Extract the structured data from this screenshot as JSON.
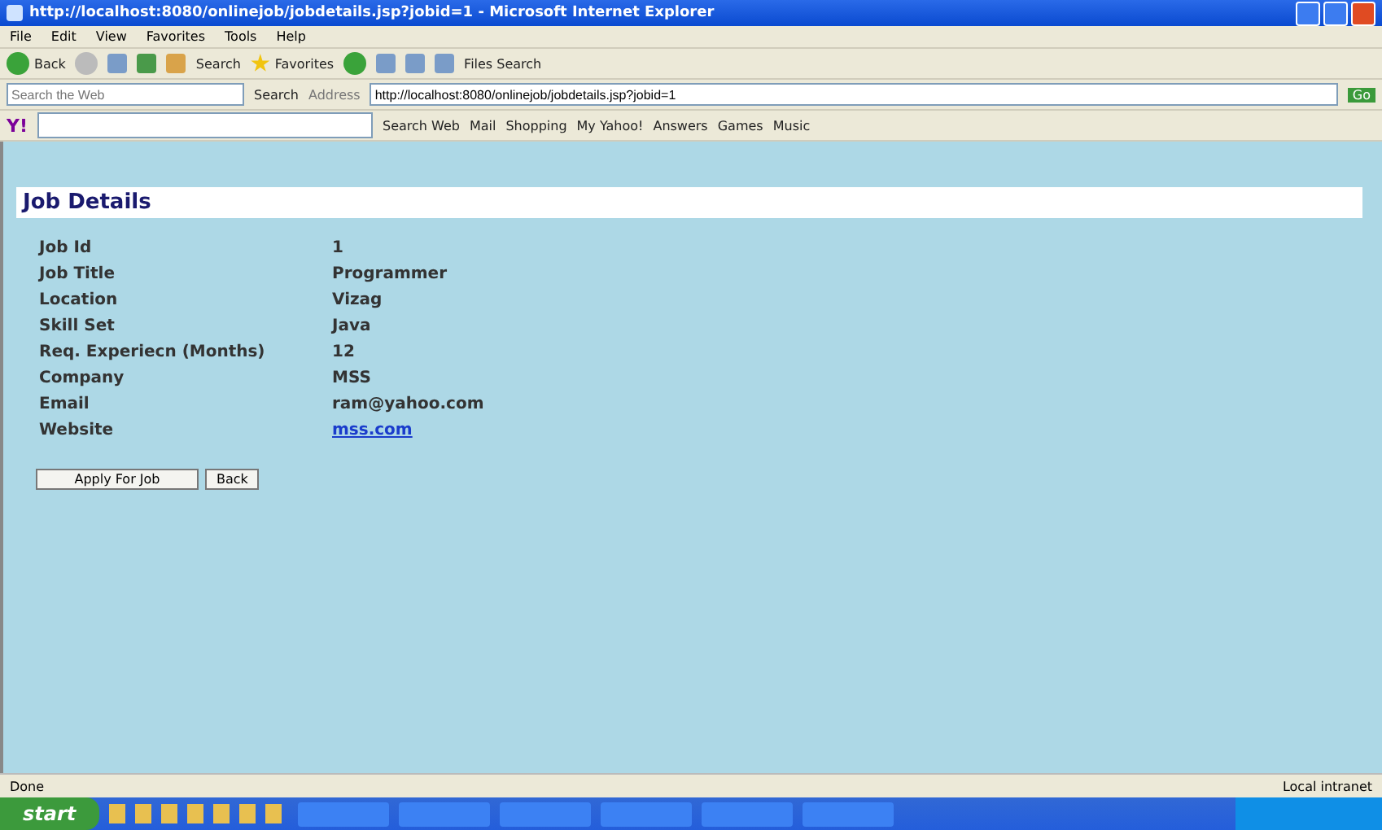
{
  "window": {
    "title": "http://localhost:8080/onlinejob/jobdetails.jsp?jobid=1 - Microsoft Internet Explorer"
  },
  "menu": [
    "File",
    "Edit",
    "View",
    "Favorites",
    "Tools",
    "Help"
  ],
  "toolbar": {
    "back": "Back",
    "search": "Search",
    "favorites": "Favorites",
    "files_search": "Files Search"
  },
  "address_bar": {
    "search_placeholder": "Search the Web",
    "search_button": "Search",
    "address_label": "Address",
    "url": "http://localhost:8080/onlinejob/jobdetails.jsp?jobid=1",
    "go": "Go"
  },
  "yahoo_bar": {
    "logo": "Y!",
    "items": [
      "Search Web",
      "Mail",
      "Shopping",
      "My Yahoo!",
      "Answers",
      "Games",
      "Music"
    ]
  },
  "page": {
    "heading": "Job Details",
    "fields": [
      {
        "label": "Job Id",
        "value": "1",
        "kind": "text"
      },
      {
        "label": "Job Title",
        "value": "Programmer",
        "kind": "text"
      },
      {
        "label": "Location",
        "value": "Vizag",
        "kind": "text"
      },
      {
        "label": "Skill Set",
        "value": "Java",
        "kind": "text"
      },
      {
        "label": "Req. Experiecn (Months)",
        "value": "12",
        "kind": "text"
      },
      {
        "label": "Company",
        "value": "MSS",
        "kind": "text"
      },
      {
        "label": "Email",
        "value": "ram@yahoo.com",
        "kind": "text"
      },
      {
        "label": "Website",
        "value": "mss.com",
        "kind": "link"
      }
    ],
    "buttons": [
      "Apply For Job",
      "Back"
    ]
  },
  "status_bar": {
    "status": "Done",
    "zone": "Local intranet"
  },
  "taskbar": {
    "start": "start"
  }
}
